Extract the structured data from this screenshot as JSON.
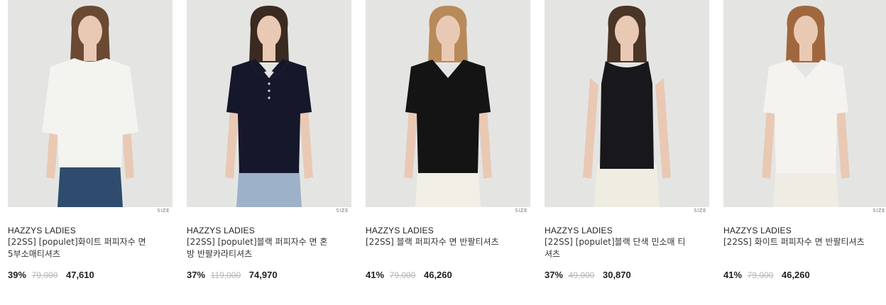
{
  "products": [
    {
      "brand": "HAZZYS LADIES",
      "name": "[22SS] [populet]화이트 퍼피자수 면 5부소매티셔츠",
      "discount": "39%",
      "original_price": "79,000",
      "price": "47,610",
      "size_label": "SIZE",
      "colors": {
        "shirt": "#f3f3f0",
        "bottom": "#2f4c6e",
        "hair": "#6a4a33"
      },
      "style": "tee"
    },
    {
      "brand": "HAZZYS LADIES",
      "name": "[22SS] [populet]블랙 퍼피자수 면 혼방 반팔카라티셔츠",
      "discount": "37%",
      "original_price": "119,000",
      "price": "74,970",
      "size_label": "SIZE",
      "colors": {
        "shirt": "#15172a",
        "bottom": "#9db2c8",
        "hair": "#3a2a20"
      },
      "style": "polo"
    },
    {
      "brand": "HAZZYS LADIES",
      "name": "[22SS] 블랙 퍼피자수 면 반팔티셔츠",
      "discount": "41%",
      "original_price": "79,000",
      "price": "46,260",
      "size_label": "SIZE",
      "colors": {
        "shirt": "#141414",
        "bottom": "#f2efe6",
        "hair": "#b88a5a"
      },
      "style": "vneck"
    },
    {
      "brand": "HAZZYS LADIES",
      "name": "[22SS] [populet]블랙 단색 민소매 티셔츠",
      "discount": "37%",
      "original_price": "49,000",
      "price": "30,870",
      "size_label": "SIZE",
      "colors": {
        "shirt": "#17171c",
        "bottom": "#efece2",
        "hair": "#4a3526"
      },
      "style": "tank"
    },
    {
      "brand": "HAZZYS LADIES",
      "name": "[22SS] 화이트 퍼피자수 면 반팔티셔츠",
      "discount": "41%",
      "original_price": "79,000",
      "price": "46,260",
      "size_label": "SIZE",
      "colors": {
        "shirt": "#f4f3ef",
        "bottom": "#efece3",
        "hair": "#a0673e"
      },
      "style": "vneck"
    }
  ]
}
